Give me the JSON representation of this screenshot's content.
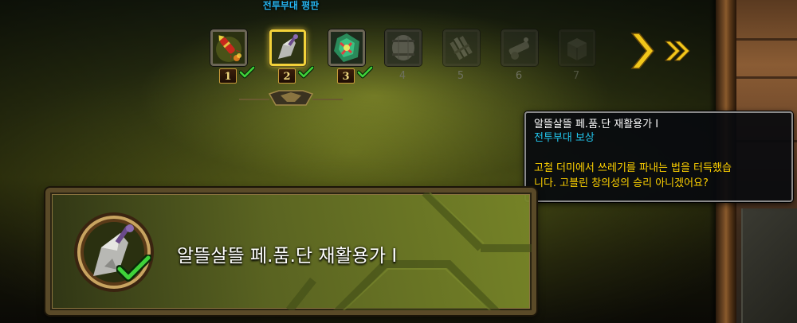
{
  "header": {
    "title": "전투부대 평판"
  },
  "tiers": [
    {
      "number": "1",
      "icon": "rocket-icon",
      "state": "earned",
      "checked": true
    },
    {
      "number": "2",
      "icon": "scrap-blade-icon",
      "state": "selected",
      "checked": true
    },
    {
      "number": "3",
      "icon": "gear-gem-icon",
      "state": "earned",
      "checked": true
    },
    {
      "number": "4",
      "icon": "barrel-icon",
      "state": "locked",
      "checked": false
    },
    {
      "number": "5",
      "icon": "rockets-bundle-icon",
      "state": "locked",
      "checked": false
    },
    {
      "number": "6",
      "icon": "cannon-icon",
      "state": "locked",
      "checked": false
    },
    {
      "number": "7",
      "icon": "crate-icon",
      "state": "locked",
      "checked": false
    }
  ],
  "tooltip": {
    "title": "알뜰살뜰 페.품.단 재활용가 I",
    "subtitle": "전투부대 보상",
    "description_line1": "고철 더미에서 쓰레기를 파내는 법을 터득했습",
    "description_line2": "니다. 고블린 창의성의 승리 아니겠어요?"
  },
  "detail": {
    "title": "알뜰살뜰 페.품.단 재활용가 I",
    "icon": "scrap-blade-icon",
    "checked": true
  },
  "colors": {
    "header_blue": "#27b6f0",
    "tooltip_title": "#ffffff",
    "tooltip_subtitle": "#22c8f0",
    "tooltip_description": "#ffd200",
    "selected_border": "#f3d23a",
    "check_green": "#3fd23a"
  }
}
